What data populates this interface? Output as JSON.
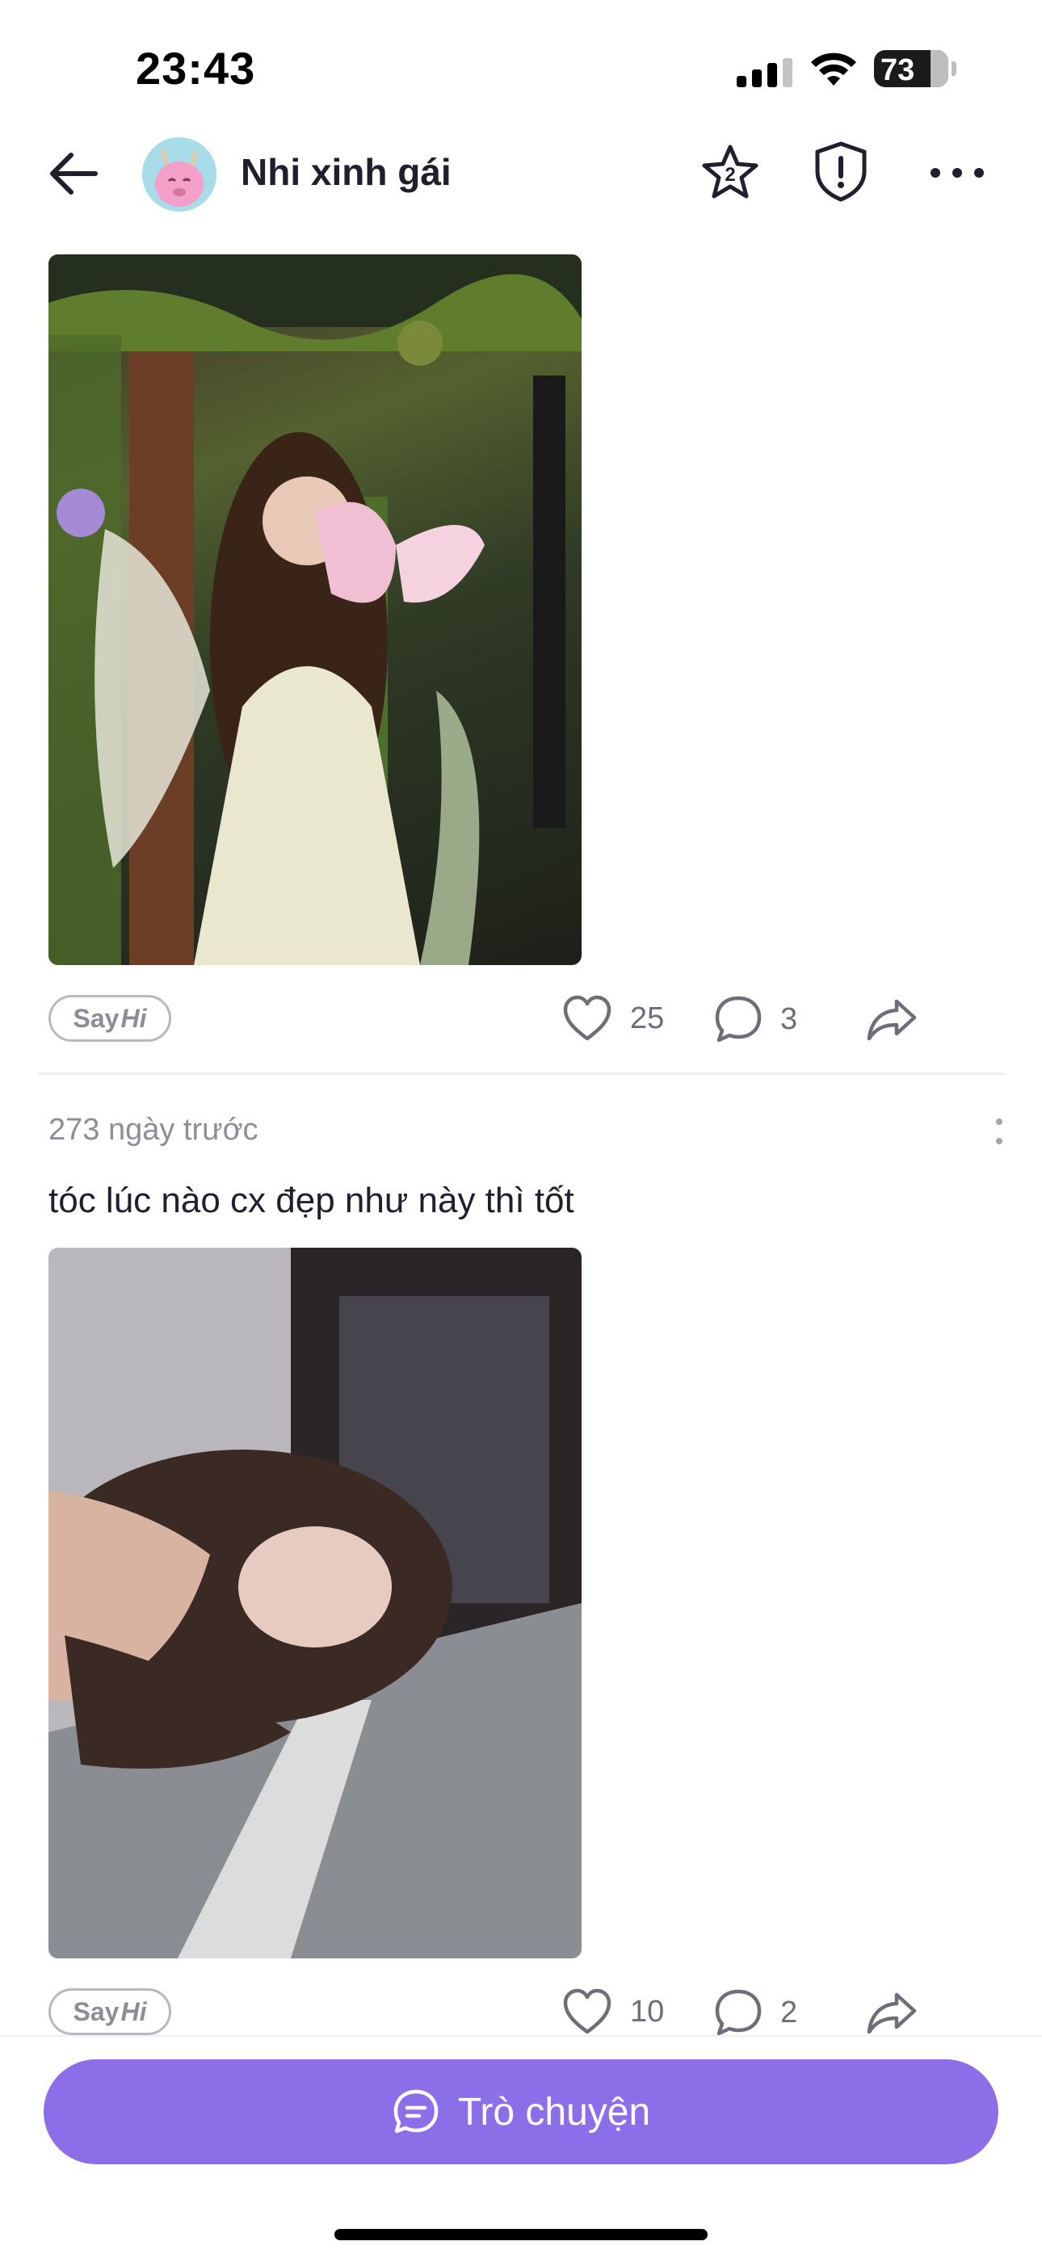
{
  "status_bar": {
    "time": "23:43",
    "battery": "73",
    "battery_level": 0.73
  },
  "header": {
    "user_name": "Nhi xinh gái",
    "star_badge": "2"
  },
  "posts": [
    {
      "image": "fairy-costume-photo",
      "sayhi": {
        "say": "Say",
        "hi": "Hi"
      },
      "likes": "25",
      "comments": "3"
    },
    {
      "time": "273 ngày trước",
      "text": "tóc lúc nào cx đẹp như này thì tốt",
      "image": "long-hair-selfie-photo",
      "sayhi": {
        "say": "Say",
        "hi": "Hi"
      },
      "likes": "10",
      "comments": "2"
    }
  ],
  "bottom": {
    "chat_label": "Trò chuyện"
  },
  "colors": {
    "accent": "#8c6ee8",
    "text": "#1f1f2e",
    "muted": "#8d8d97"
  }
}
